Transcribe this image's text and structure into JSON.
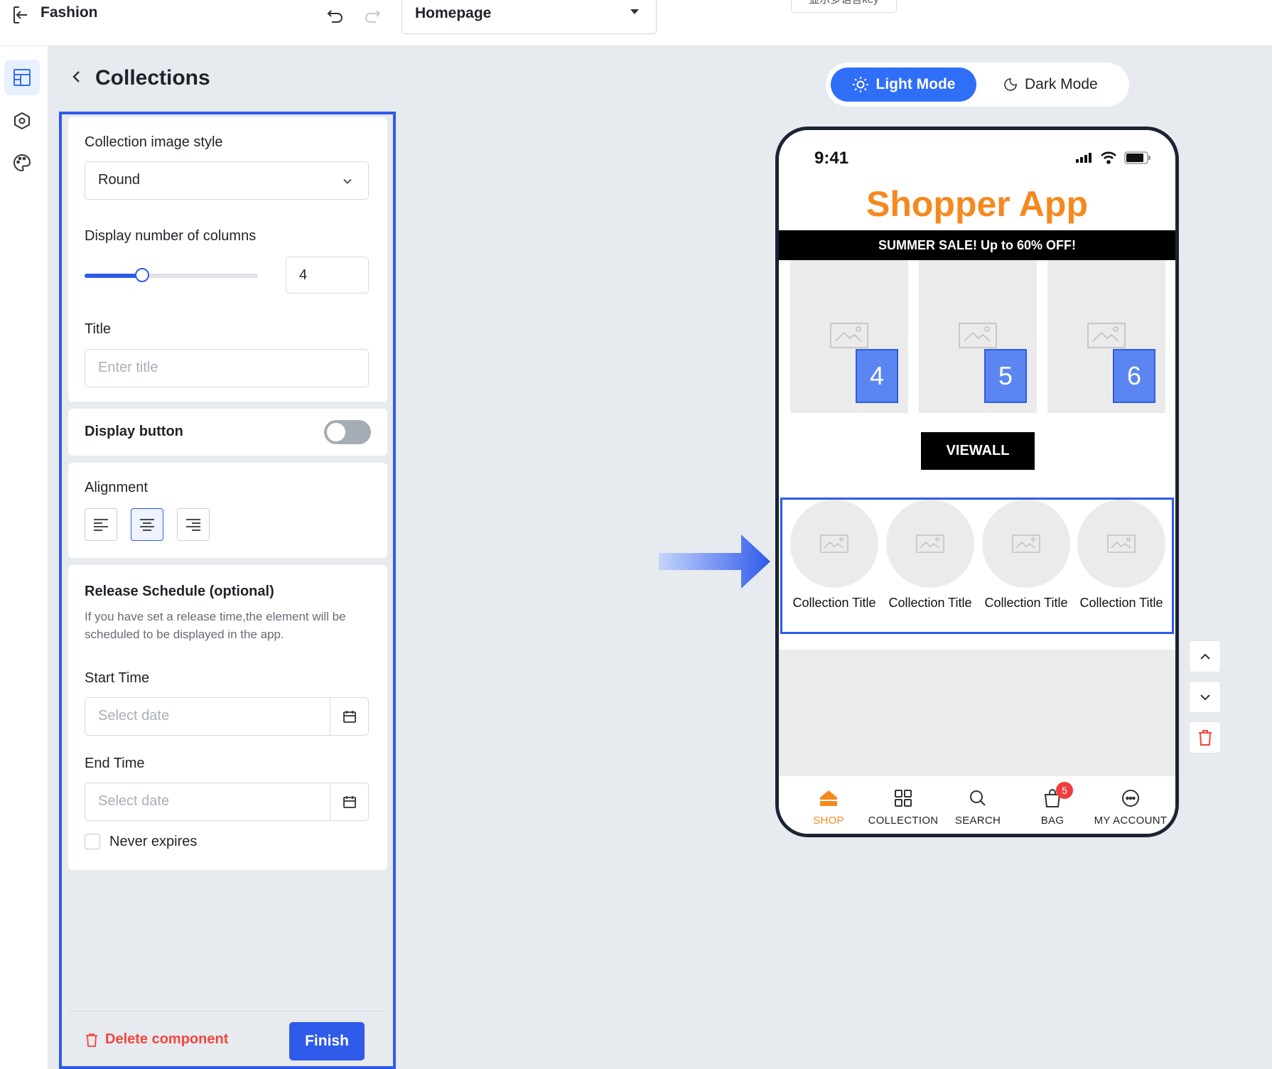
{
  "header": {
    "app_name": "Fashion",
    "page_select": "Homepage",
    "lang_key_button": "显示多语言key"
  },
  "panel": {
    "title": "Collections",
    "image_style_label": "Collection image style",
    "image_style_value": "Round",
    "columns_label": "Display number of columns",
    "columns_value": "4",
    "columns_slider_fraction": 0.33,
    "title_label": "Title",
    "title_placeholder": "Enter title",
    "display_button_label": "Display button",
    "display_button_on": false,
    "alignment_label": "Alignment",
    "alignment_selected": "center",
    "release_title": "Release Schedule (optional)",
    "release_desc": "If you have set a release time,the element will be scheduled to be displayed in the app.",
    "start_label": "Start Time",
    "start_placeholder": "Select date",
    "end_label": "End Time",
    "end_placeholder": "Select date",
    "never_expires_label": "Never expires",
    "delete_label": "Delete component",
    "finish_label": "Finish"
  },
  "preview": {
    "light_mode": "Light Mode",
    "dark_mode": "Dark Mode",
    "time": "9:41",
    "app_title": "Shopper App",
    "sale_text": "SUMMER SALE! Up to 60% OFF!",
    "tile_numbers": [
      "4",
      "5",
      "6"
    ],
    "viewall_label": "VIEWALL",
    "collections": [
      {
        "title": "Collection Title"
      },
      {
        "title": "Collection Title"
      },
      {
        "title": "Collection Title"
      },
      {
        "title": "Collection Title"
      }
    ],
    "tabs": [
      {
        "label": "SHOP",
        "icon": "home-icon"
      },
      {
        "label": "COLLECTION",
        "icon": "grid-icon"
      },
      {
        "label": "SEARCH",
        "icon": "search-icon"
      },
      {
        "label": "BAG",
        "icon": "bag-icon"
      },
      {
        "label": "MY ACCOUNT",
        "icon": "account-icon"
      }
    ],
    "bag_count": "5"
  },
  "colors": {
    "accent": "#2f5bea",
    "brand_orange": "#f5891f",
    "danger": "#f2463d"
  }
}
